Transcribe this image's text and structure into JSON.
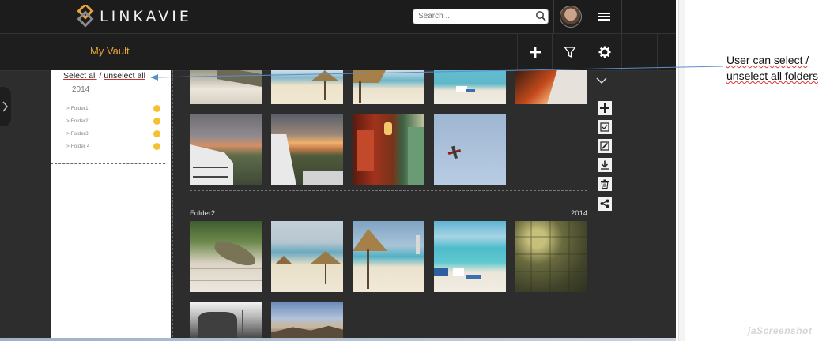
{
  "header": {
    "brand": "LINKAVIE",
    "search_placeholder": "Search ...",
    "icons": [
      "logo-icon",
      "search-icon",
      "avatar",
      "menu-icon"
    ]
  },
  "subheader": {
    "title": "My Vault",
    "actions": [
      "add-icon",
      "filter-icon",
      "settings-icon"
    ]
  },
  "sidebar": {
    "select_all": "Select all",
    "separator": " / ",
    "unselect_all": "unselect all",
    "year": "2014",
    "folders": [
      {
        "label": "> Folder1"
      },
      {
        "label": "> Folder2"
      },
      {
        "label": "> Folder3"
      },
      {
        "label": "> Folder 4"
      }
    ],
    "dot_color": "#f5c133"
  },
  "gallery": {
    "section2": {
      "name": "Folder2",
      "year": "2014"
    }
  },
  "toolbar": {
    "icons": [
      "add-icon",
      "select-icon",
      "edit-icon",
      "download-icon",
      "delete-icon",
      "share-icon"
    ]
  },
  "annotation": {
    "line1": "User can select /",
    "line2": "unselect all folders"
  },
  "watermark": "jaScreenshot",
  "colors": {
    "accent": "#e8a33a",
    "header_bg": "#1c1c1c",
    "content_bg": "#2d2d2d"
  }
}
